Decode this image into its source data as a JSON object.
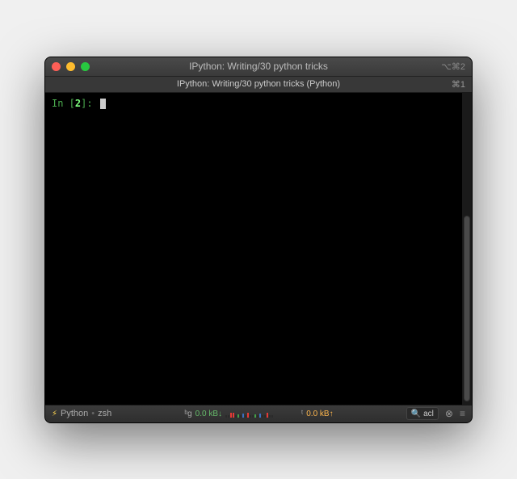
{
  "titlebar": {
    "title": "IPython: Writing/30 python tricks",
    "right_indicator": "⌥⌘2"
  },
  "tab": {
    "label": "IPython: Writing/30 python tricks (Python)",
    "index_label": "⌘1"
  },
  "terminal": {
    "prompt_prefix": "In [",
    "prompt_number": "2",
    "prompt_suffix": "]: "
  },
  "statusbar": {
    "process": "Python",
    "shell": "zsh",
    "net_down": "0.0 kB↓",
    "net_up": "0.0 kB↑",
    "net_prefix": "ᵇg",
    "net_suffix": "ᵗ",
    "search_value": "acl"
  }
}
